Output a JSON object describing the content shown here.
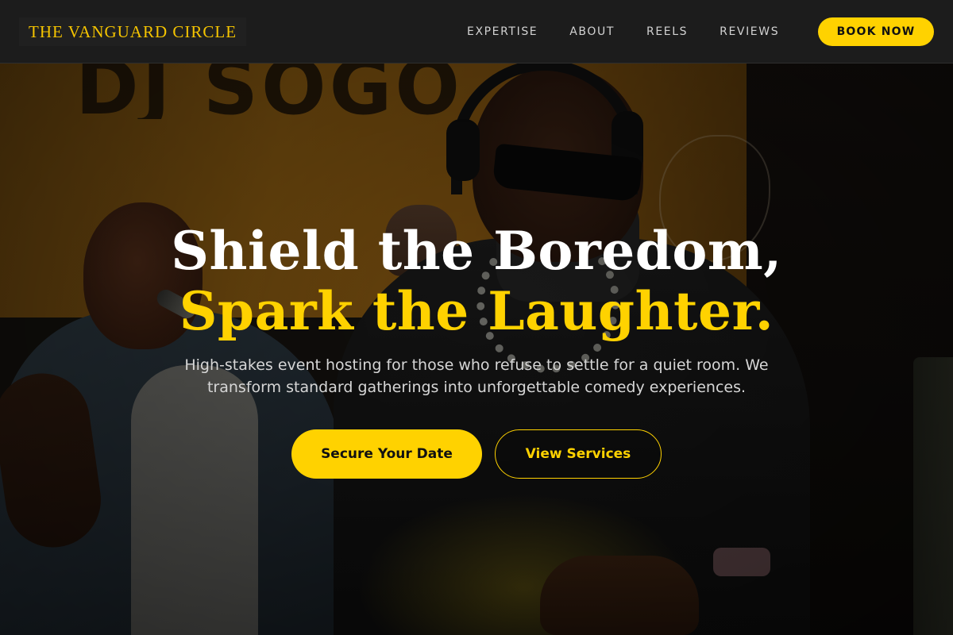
{
  "brand": {
    "logo_text": "THE VANGUARD CIRCLE",
    "accent_color": "#ffd200"
  },
  "nav": {
    "links": [
      {
        "label": "EXPERTISE"
      },
      {
        "label": "ABOUT"
      },
      {
        "label": "REELS"
      },
      {
        "label": "REVIEWS"
      }
    ],
    "cta_label": "BOOK NOW"
  },
  "hero": {
    "headline_line1": "Shield the Boredom,",
    "headline_line2": "Spark the Laughter.",
    "subtext": "High-stakes event hosting for those who refuse to settle for a quiet room. We transform standard gatherings into unforgettable comedy experiences.",
    "primary_cta": "Secure Your Date",
    "secondary_cta": "View Services",
    "background_image": "photo-dj-and-mc-performing"
  }
}
